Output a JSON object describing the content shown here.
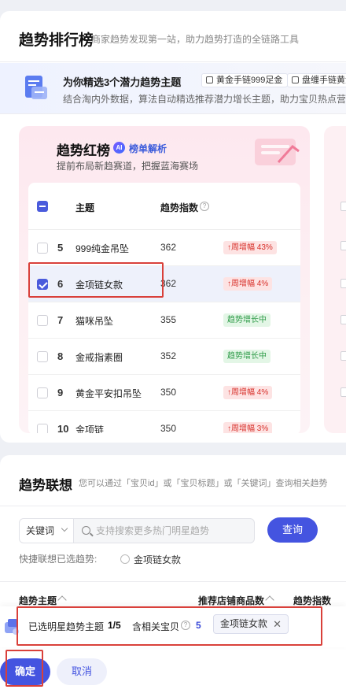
{
  "header": {
    "title": "趋势排行榜",
    "subtitle": "商家趋势发现第一站，助力趋势打造的全链路工具"
  },
  "promo": {
    "title": "为你精选3个潜力趋势主题",
    "chips": [
      "黄金手链999足金",
      "盘缠手链黄金"
    ],
    "desc": "结合淘内外数据，算法自动精选推荐潜力增长主题，助力宝贝热点营销"
  },
  "trend_red": {
    "title": "趋势红榜",
    "ai_badge": "AI",
    "ai_link": "榜单解析",
    "subtitle": "提前布局新趋赛道，把握蓝海赛场",
    "columns": {
      "topic": "主题",
      "index": "趋势指数"
    },
    "rows": [
      {
        "rank": "5",
        "name": "999纯金吊坠",
        "value": "362",
        "tag": "↑周增幅 43%",
        "tag_type": "up",
        "checked": false
      },
      {
        "rank": "6",
        "name": "金项链女款",
        "value": "362",
        "tag": "↑周增幅 4%",
        "tag_type": "up",
        "checked": true
      },
      {
        "rank": "7",
        "name": "猫咪吊坠",
        "value": "355",
        "tag": "趋势增长中",
        "tag_type": "grow",
        "checked": false
      },
      {
        "rank": "8",
        "name": "金戒指素圈",
        "value": "352",
        "tag": "趋势增长中",
        "tag_type": "grow",
        "checked": false
      },
      {
        "rank": "9",
        "name": "黄金平安扣吊坠",
        "value": "350",
        "tag": "↑周增幅 4%",
        "tag_type": "up",
        "checked": false
      },
      {
        "rank": "10",
        "name": "金项链",
        "value": "350",
        "tag": "↑周增幅 3%",
        "tag_type": "up",
        "checked": false
      }
    ]
  },
  "association": {
    "title": "趋势联想",
    "subtitle": "您可以通过「宝贝id」或「宝贝标题」或「关键词」查询相关趋势",
    "select_value": "关键词",
    "search_placeholder": "支持搜索更多热门明星趋势",
    "query_button": "查询",
    "quick_label": "快捷联想已选趋势:",
    "quick_option": "金项链女款",
    "columns": [
      "趋势主题",
      "推荐店铺商品数",
      "趋势指数"
    ]
  },
  "selection_bar": {
    "text1": "已选明星趋势主题",
    "count": "1/5",
    "text2": "含相关宝贝",
    "item_count": "5",
    "chip": "金项链女款",
    "chip_close": "✕"
  },
  "footer": {
    "confirm": "确定",
    "cancel": "取消"
  }
}
